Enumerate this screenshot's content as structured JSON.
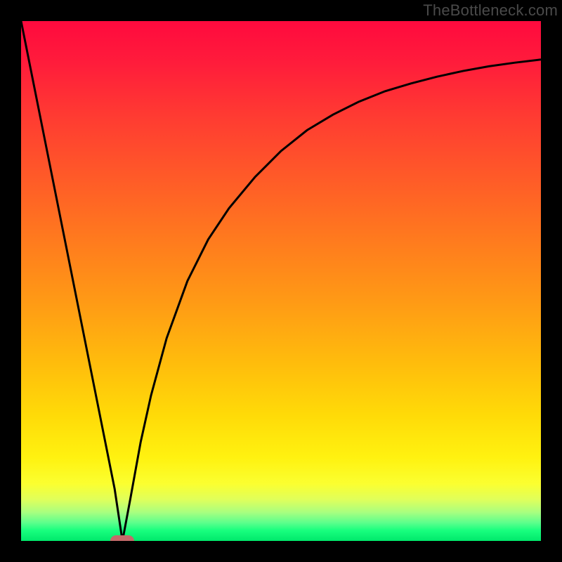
{
  "watermark": "TheBottleneck.com",
  "chart_data": {
    "type": "line",
    "title": "",
    "xlabel": "",
    "ylabel": "",
    "xlim": [
      0,
      100
    ],
    "ylim": [
      0,
      100
    ],
    "x": [
      0,
      2,
      4,
      6,
      8,
      10,
      12,
      14,
      16,
      18,
      19.5,
      21,
      23,
      25,
      28,
      32,
      36,
      40,
      45,
      50,
      55,
      60,
      65,
      70,
      75,
      80,
      85,
      90,
      95,
      100
    ],
    "values": [
      100,
      90,
      80,
      70,
      60,
      50,
      40,
      30,
      20,
      10,
      0,
      8,
      19,
      28,
      39,
      50,
      58,
      64,
      70,
      75,
      79,
      82,
      84.5,
      86.5,
      88,
      89.3,
      90.4,
      91.3,
      92,
      92.6
    ],
    "annotations": [
      {
        "type": "marker",
        "x": 19.5,
        "y": 0,
        "color": "#c46a6a",
        "shape": "pill"
      }
    ],
    "background": "vertical-gradient red→orange→yellow→green",
    "grid": false,
    "legend": null
  },
  "colors": {
    "frame": "#000000",
    "curve": "#000000",
    "marker": "#c46a6a"
  }
}
